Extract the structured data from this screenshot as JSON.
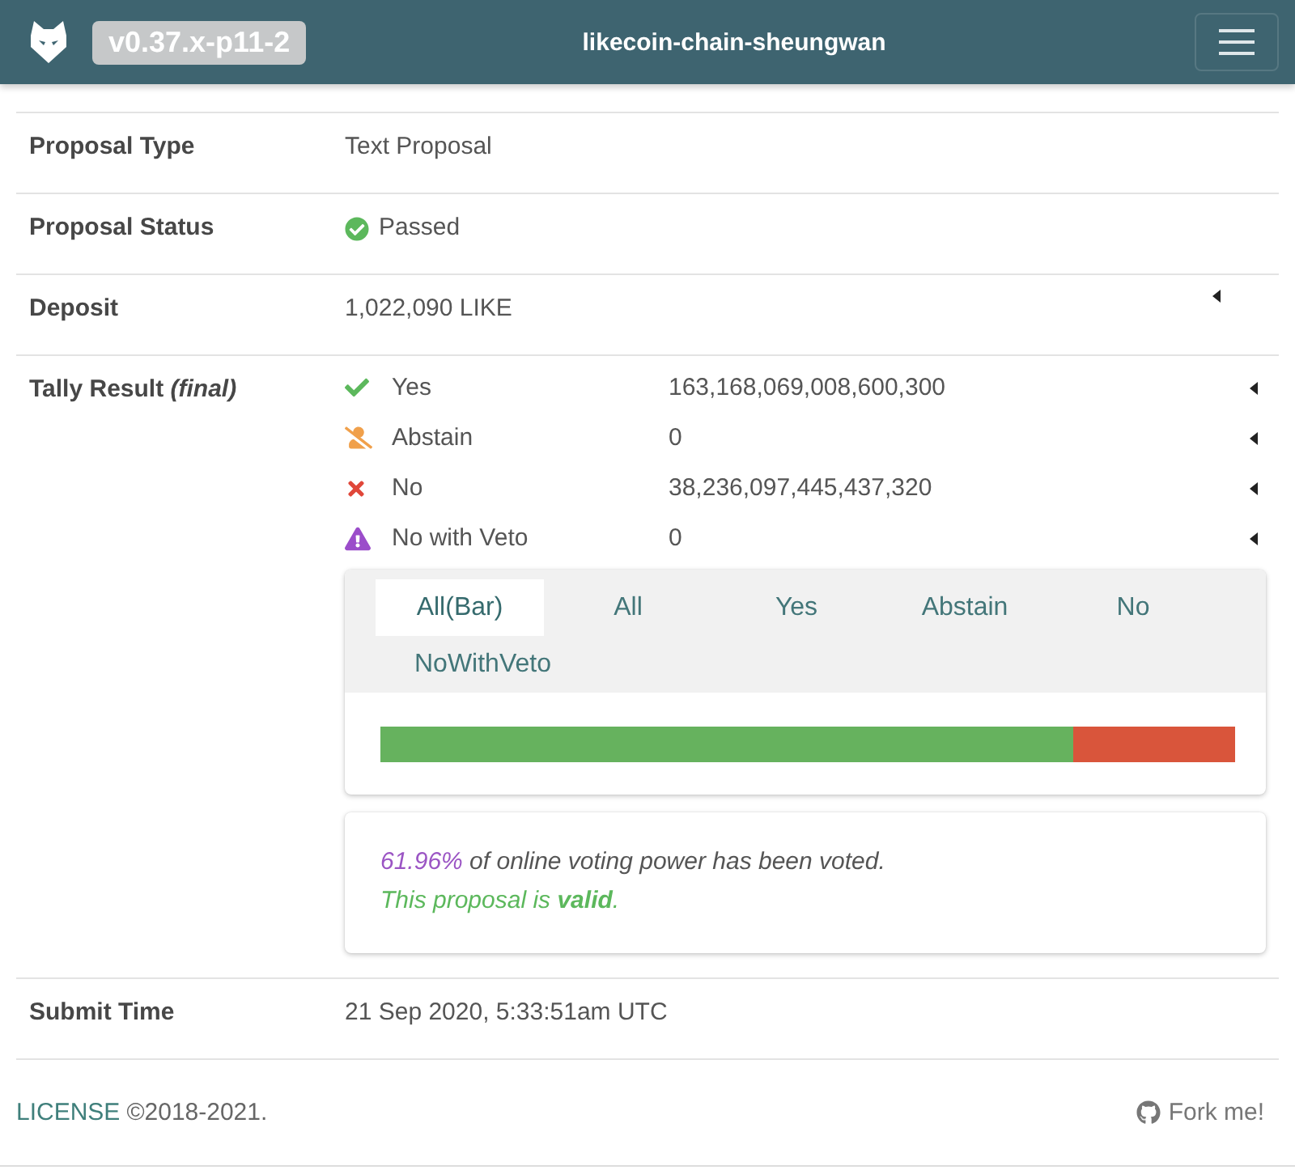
{
  "header": {
    "version": "v0.37.x-p11-2",
    "title": "likecoin-chain-sheungwan"
  },
  "rows": [
    {
      "kind": "text",
      "label": "Proposal Type",
      "value": "Text Proposal"
    },
    {
      "kind": "status",
      "label": "Proposal Status",
      "value": "Passed",
      "passed": true
    },
    {
      "kind": "amount",
      "label": "Deposit",
      "value": "1,022,090 LIKE",
      "expanded": false
    },
    {
      "kind": "tally",
      "label": "Tally Result *(final)*",
      "options": [
        {
          "kind": "yes",
          "label": "Yes",
          "value": "163,168,069,008,600,300",
          "expanded": false
        },
        {
          "kind": "abstain",
          "label": "Abstain",
          "value": "0",
          "expanded": false
        },
        {
          "kind": "no",
          "label": "No",
          "value": "38,236,097,445,437,320",
          "expanded": false
        },
        {
          "kind": "veto",
          "label": "No with Veto",
          "value": "0",
          "expanded": false
        }
      ],
      "tabs": [
        {
          "label": "All(Bar)",
          "selected": true
        },
        {
          "label": "All",
          "selected": false
        },
        {
          "label": "Yes",
          "selected": false
        },
        {
          "label": "Abstain",
          "selected": false
        },
        {
          "label": "No",
          "selected": false
        },
        {
          "label": "NoWithVeto",
          "selected": false
        }
      ],
      "bar": [
        {
          "color": "#66b25e",
          "level": 0.81
        },
        {
          "color": "#d9553b",
          "level": 0.19
        }
      ],
      "summary": {
        "percent": "61.96%",
        "text": "of online voting power has been voted.",
        "verdict": "This proposal is **valid**.",
        "valid": true
      }
    },
    {
      "kind": "text",
      "label": "Submit Time",
      "value": "21 Sep 2020, 5:33:51am UTC"
    }
  ],
  "footer": {
    "link": "LICENSE",
    "copyright": "©2018-2021.",
    "fork": "Fork me!"
  }
}
